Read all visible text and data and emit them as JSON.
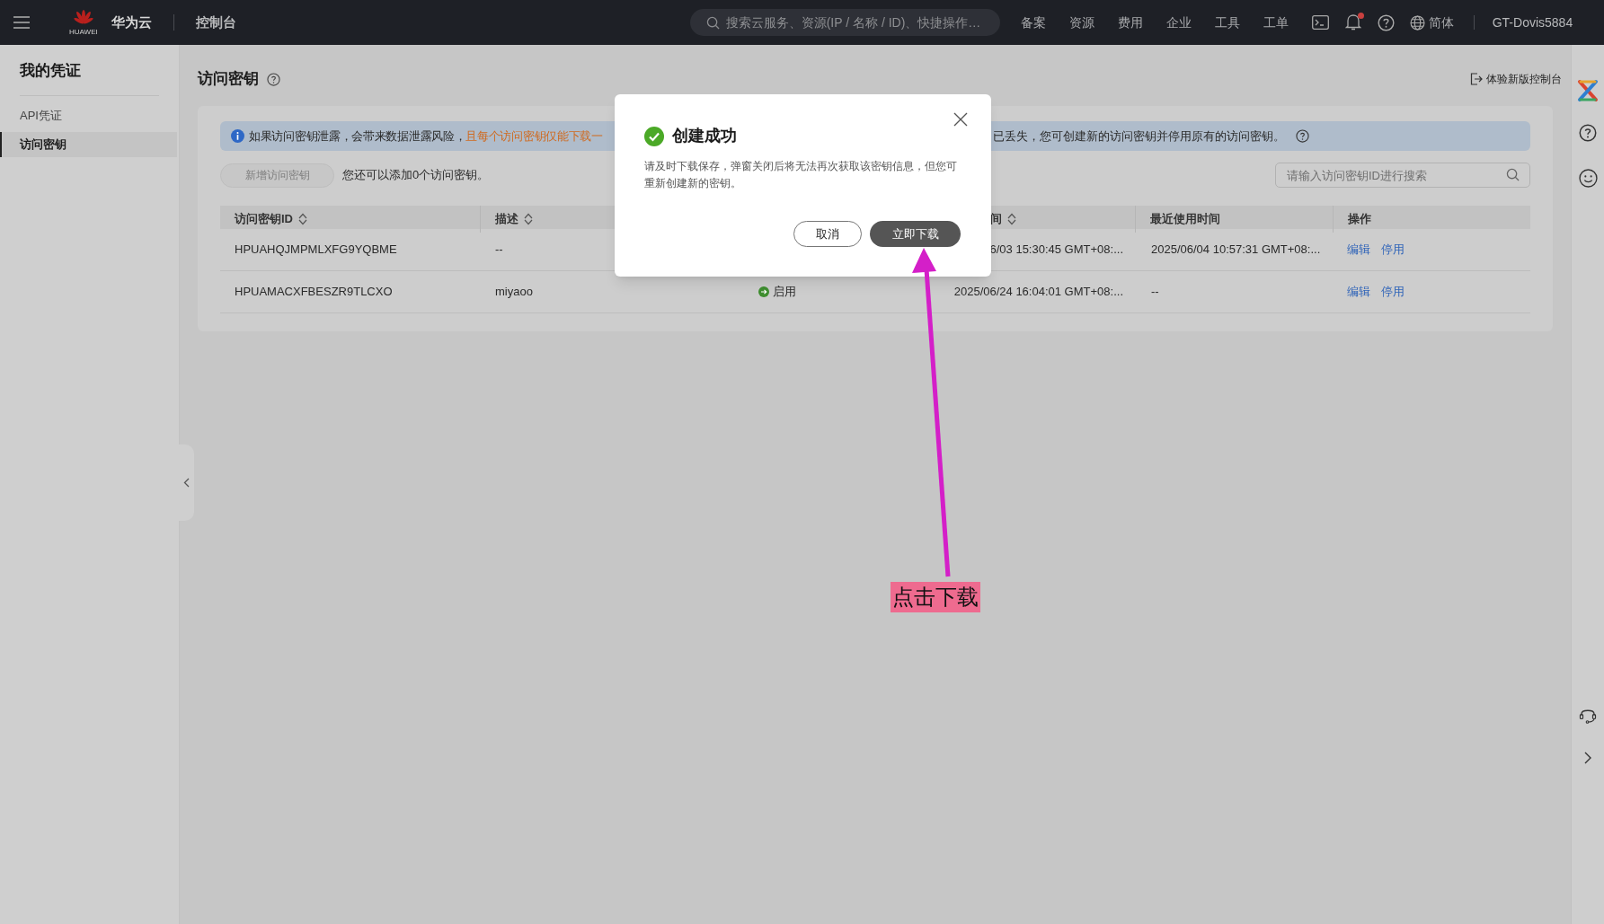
{
  "topbar": {
    "logo_caption": "HUAWEI",
    "brand": "华为云",
    "console": "控制台",
    "search": {
      "placeholder": "搜索云服务、资源(IP / 名称 / ID)、快捷操作…"
    },
    "nav": [
      "备案",
      "资源",
      "费用",
      "企业",
      "工具",
      "工单"
    ],
    "notifications_unread": true,
    "language": "简体",
    "user": "GT-Dovis5884"
  },
  "sidebar": {
    "title": "我的凭证",
    "items": [
      {
        "label": "API凭证",
        "selected": false
      },
      {
        "label": "访问密钥",
        "selected": true
      }
    ]
  },
  "page": {
    "title": "访问密钥",
    "new_console_link": "体验新版控制台"
  },
  "banner": {
    "text": "如果访问密钥泄露，会带来数据泄露风险，",
    "highlight": "且每个访问密钥仅能下载一",
    "text_after": "已丢失，您可创建新的访问密钥并停用原有的访问密钥。"
  },
  "toolbar": {
    "add_button": {
      "label": "新增访问密钥",
      "disabled": true
    },
    "quota_note": "您还可以添加0个访问密钥。",
    "search": {
      "placeholder": "请输入访问密钥ID进行搜索"
    }
  },
  "table": {
    "columns": [
      {
        "label": "访问密钥ID",
        "sortable": true
      },
      {
        "label": "描述",
        "sortable": true
      },
      {
        "label": "间",
        "sortable": true
      },
      {
        "label": "最近使用时间",
        "sortable": false
      },
      {
        "label": "操作",
        "sortable": false
      }
    ],
    "rows": [
      {
        "access_key_id": "HPUAHQJMPMLXFG9YQBME",
        "description": "--",
        "created": "6/03 15:30:45 GMT+08:...",
        "last_used": "2025/06/04 10:57:31 GMT+08:...",
        "actions": [
          "编辑",
          "停用"
        ]
      },
      {
        "access_key_id": "HPUAMACXFBESZR9TLCXO",
        "description": "miyaoo",
        "status": {
          "label": "启用",
          "enabled": true
        },
        "created": "2025/06/24 16:04:01 GMT+08:...",
        "last_used": "--",
        "actions": [
          "编辑",
          "停用"
        ]
      }
    ]
  },
  "dialog": {
    "title": "创建成功",
    "message": "请及时下载保存，弹窗关闭后将无法再次获取该密钥信息，但您可重新创建新的密钥。",
    "buttons": [
      {
        "label": "取消",
        "primary": false
      },
      {
        "label": "立即下载",
        "primary": true
      }
    ]
  },
  "annotation": {
    "label": "点击下载"
  }
}
